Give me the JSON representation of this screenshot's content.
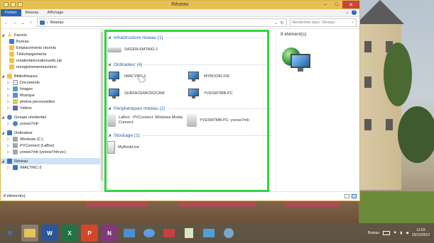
{
  "window": {
    "title": "Réseau",
    "minimize_glyph": "–",
    "maximize_glyph": "□",
    "close_glyph": "✕"
  },
  "ribbon": {
    "tabs": [
      "Fichier",
      "Réseau",
      "Affichage"
    ],
    "expand_glyph": "⌄",
    "help_glyph": "?"
  },
  "address_bar": {
    "back_glyph": "←",
    "forward_glyph": "→",
    "history_glyph": "⌄",
    "up_glyph": "↑",
    "separator": "›",
    "location": "Réseau",
    "dropdown_glyph": "⌄",
    "refresh_glyph": "↻",
    "search_placeholder": "Rechercher dans : Réseau",
    "search_glyph": "⌕"
  },
  "navigation": {
    "favoris": {
      "label": "Favoris",
      "items": [
        "Bureau",
        "Emplacements récents",
        "Téléchargements",
        "residentielcreationumb.zip",
        "enregistrementsactions"
      ]
    },
    "bibliotheques": {
      "label": "Bibliothèques",
      "items": [
        "Documents",
        "Images",
        "Musique",
        "photos personnelles",
        "Vidéos"
      ]
    },
    "groupe": {
      "label": "Groupe résidentiel",
      "items": [
        "yvesw7mb"
      ]
    },
    "ordinateur": {
      "label": "Ordinateur",
      "items": [
        "Windows (C:)",
        "PVConnect (LaBox)",
        "yvesw7mb (yvesw7mb-pc)"
      ]
    },
    "reseau": {
      "label": "Réseau",
      "items": [
        "IMACYRC-3"
      ]
    }
  },
  "content": {
    "groups": [
      {
        "title": "Infrastructure réseau (1)",
        "items": [
          {
            "label": "SAGEM EMTA42-1",
            "icon": "router-icon"
          }
        ]
      },
      {
        "title": "Ordinateur (4)",
        "items": [
          {
            "label": "IMACYRC-3",
            "icon": "computer-icon"
          },
          {
            "label": "MYBOOKLIVE",
            "icon": "computer-icon"
          },
          {
            "label": "SURFACEMICROCAM",
            "icon": "computer-icon"
          },
          {
            "label": "YVESW7MB-PC",
            "icon": "computer-icon"
          }
        ]
      },
      {
        "title": "Périphériques médias (2)",
        "items": [
          {
            "label": "LaBox : PVConnect: Windows Media Connect",
            "icon": "media-device-icon"
          },
          {
            "label": "YVESW7MB-PC: yvesw7mb",
            "icon": "media-device-icon"
          }
        ]
      },
      {
        "title": "Stockage (1)",
        "items": [
          {
            "label": "MyBookLive",
            "icon": "storage-icon"
          }
        ]
      }
    ]
  },
  "details": {
    "count": "8 élément(s)"
  },
  "status": {
    "count": "8 élément(s)"
  },
  "taskbar": {
    "apps": [
      {
        "label": "e",
        "color": "#2f86d6",
        "icon": "internet-explorer-icon"
      },
      {
        "label": "",
        "color": "#e9c25a",
        "icon": "file-explorer-icon"
      },
      {
        "label": "W",
        "color": "#2b579a",
        "icon": "word-icon"
      },
      {
        "label": "X",
        "color": "#217346",
        "icon": "excel-icon"
      },
      {
        "label": "P",
        "color": "#d24726",
        "icon": "powerpoint-icon"
      },
      {
        "label": "N",
        "color": "#80397b",
        "icon": "onenote-icon"
      },
      {
        "label": "",
        "color": "#4a8fd6",
        "icon": "remote-desktop-icon"
      },
      {
        "label": "",
        "color": "#5aa0e0",
        "icon": "network-icon"
      },
      {
        "label": "",
        "color": "#c94040",
        "icon": "media-app-icon"
      },
      {
        "label": "",
        "color": "#8fbf5a",
        "icon": "notepad-icon"
      },
      {
        "label": "",
        "color": "#4f9fd8",
        "icon": "paint-icon"
      },
      {
        "label": "",
        "color": "#7aa6c8",
        "icon": "settings-icon"
      }
    ],
    "desktop_label": "Bureau",
    "time": "11:53",
    "date": "25/12/2012"
  }
}
